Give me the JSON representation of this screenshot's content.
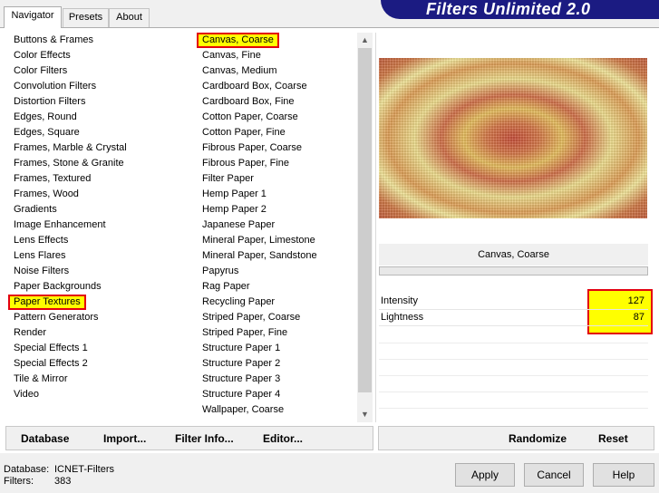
{
  "tabs": [
    {
      "label": "Navigator",
      "active": true
    },
    {
      "label": "Presets",
      "active": false
    },
    {
      "label": "About",
      "active": false
    }
  ],
  "title": "Filters Unlimited 2.0",
  "categories": [
    "Buttons & Frames",
    "Color Effects",
    "Color Filters",
    "Convolution Filters",
    "Distortion Filters",
    "Edges, Round",
    "Edges, Square",
    "Frames, Marble & Crystal",
    "Frames, Stone & Granite",
    "Frames, Textured",
    "Frames, Wood",
    "Gradients",
    "Image Enhancement",
    "Lens Effects",
    "Lens Flares",
    "Noise Filters",
    "Paper Backgrounds",
    "Paper Textures",
    "Pattern Generators",
    "Render",
    "Special Effects 1",
    "Special Effects 2",
    "Tile & Mirror",
    "Video"
  ],
  "selected_category": "Paper Textures",
  "filters": [
    "Canvas, Coarse",
    "Canvas, Fine",
    "Canvas, Medium",
    "Cardboard Box, Coarse",
    "Cardboard Box, Fine",
    "Cotton Paper, Coarse",
    "Cotton Paper, Fine",
    "Fibrous Paper, Coarse",
    "Fibrous Paper, Fine",
    "Filter Paper",
    "Hemp Paper 1",
    "Hemp Paper 2",
    "Japanese Paper",
    "Mineral Paper, Limestone",
    "Mineral Paper, Sandstone",
    "Papyrus",
    "Rag Paper",
    "Recycling Paper",
    "Striped Paper, Coarse",
    "Striped Paper, Fine",
    "Structure Paper 1",
    "Structure Paper 2",
    "Structure Paper 3",
    "Structure Paper 4",
    "Wallpaper, Coarse"
  ],
  "selected_filter": "Canvas, Coarse",
  "preview": {
    "filter_name": "Canvas, Coarse"
  },
  "params": [
    {
      "label": "Intensity",
      "value": "127"
    },
    {
      "label": "Lightness",
      "value": "87"
    }
  ],
  "toolbar": {
    "database": "Database",
    "import": "Import...",
    "filter_info": "Filter Info...",
    "editor": "Editor...",
    "randomize": "Randomize",
    "reset": "Reset"
  },
  "footer": {
    "database_label": "Database:",
    "database_value": "ICNET-Filters",
    "filters_label": "Filters:",
    "filters_value": "383"
  },
  "buttons": {
    "apply": "Apply",
    "cancel": "Cancel",
    "help": "Help"
  },
  "colors": {
    "highlight": "#ffff00",
    "highlight_border": "#e3000f",
    "banner": "#1b1b82"
  }
}
